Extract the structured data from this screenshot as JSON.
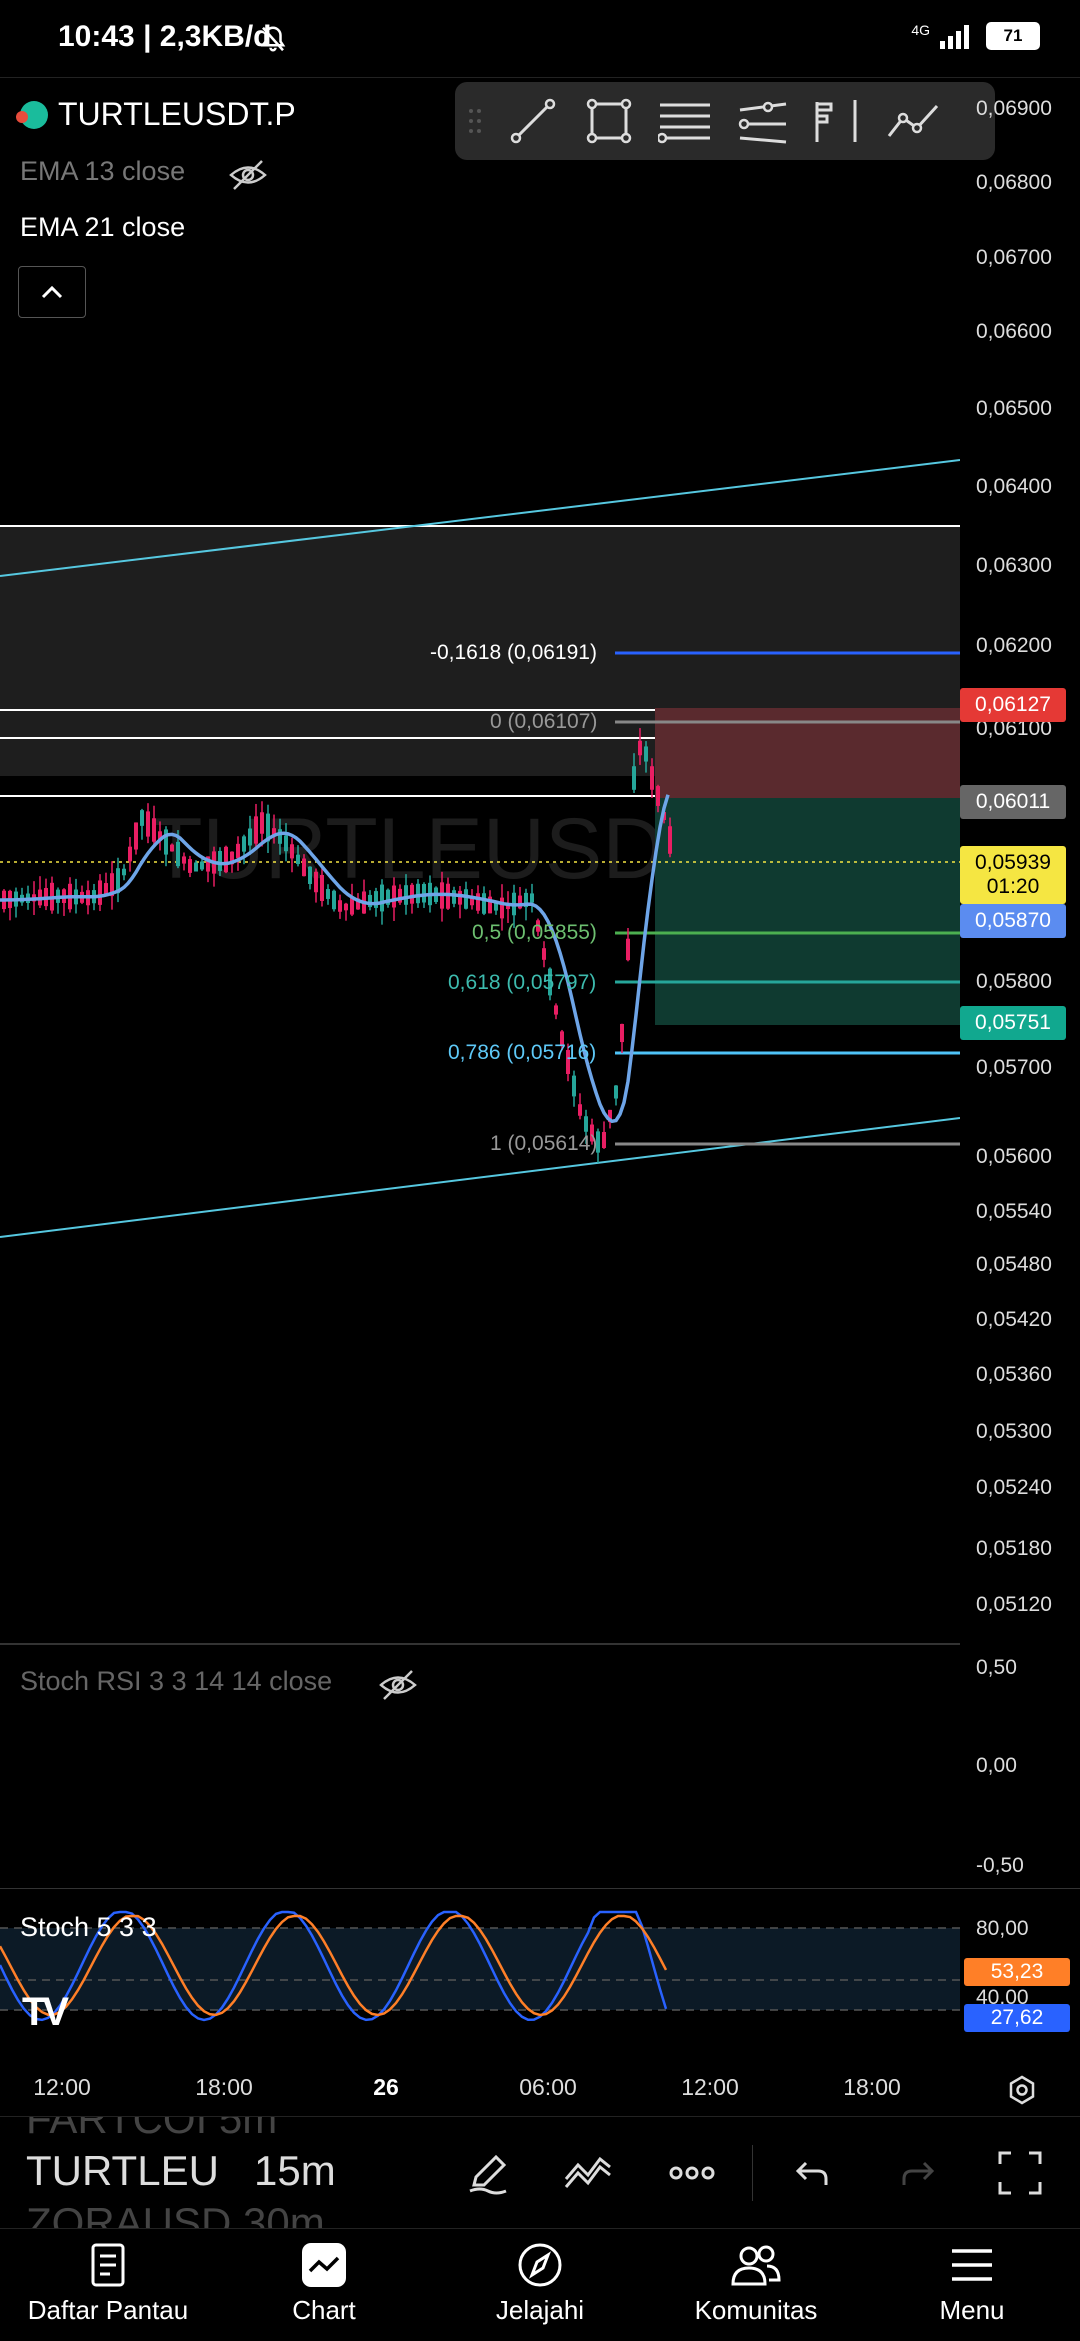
{
  "status_bar": {
    "time": "10:43 | 2,3KB/d",
    "network": "4G",
    "battery": "71"
  },
  "chart": {
    "symbol": "TURTLEUSDT.P",
    "watermark": "TURTLEUSDT.P",
    "indicators": {
      "ema13": "EMA 13 close",
      "ema21": "EMA 21 close"
    },
    "price_ticks": [
      "0,06900",
      "0,06800",
      "0,06700",
      "0,06600",
      "0,06500",
      "0,06400",
      "0,06300",
      "0,06200",
      "0,06100",
      "0,05800",
      "0,05700",
      "0,05600",
      "0,05540",
      "0,05480",
      "0,05420",
      "0,05360",
      "0,05300",
      "0,05240",
      "0,05180",
      "0,05120"
    ],
    "price_tags": {
      "stop": "0,06127",
      "entry": "0,06011",
      "current": "0,05939",
      "countdown": "01:20",
      "ema": "0,05870",
      "target": "0,05751"
    },
    "fib_levels": [
      {
        "label": "-0,1618 (0,06191)",
        "color": "#2962ff"
      },
      {
        "label": "0 (0,06107)",
        "color": "#888888"
      },
      {
        "label": "0,5 (0,05855)",
        "color": "#4caf50"
      },
      {
        "label": "0,618 (0,05797)",
        "color": "#26a69a"
      },
      {
        "label": "0,786 (0,05716)",
        "color": "#4fc3f7"
      },
      {
        "label": "1 (0,05614)",
        "color": "#888888"
      }
    ],
    "colors": {
      "up": "#26a69a",
      "down": "#e91e63",
      "ema": "#6ea5e8",
      "channel": "#56c8e0"
    }
  },
  "stoch_rsi": {
    "label": "Stoch RSI 3 3 14 14 close",
    "ticks": [
      "0,50",
      "0,00",
      "-0,50"
    ]
  },
  "stoch": {
    "label": "Stoch 5 3 3",
    "ticks": [
      "80,00",
      "40,00"
    ],
    "k": "53,23",
    "d": "27,62"
  },
  "time_axis": [
    "12:00",
    "18:00",
    "26",
    "06:00",
    "12:00",
    "18:00"
  ],
  "bottom_toolbar": {
    "ghost_above": "FARTCOI 5m",
    "symbol": "TURTLEU",
    "interval": "15m",
    "ghost_below": "ZORAUSD 30m"
  },
  "nav": [
    {
      "label": "Daftar Pantau",
      "icon": "watchlist-icon"
    },
    {
      "label": "Chart",
      "icon": "chart-icon"
    },
    {
      "label": "Jelajahi",
      "icon": "compass-icon"
    },
    {
      "label": "Komunitas",
      "icon": "community-icon"
    },
    {
      "label": "Menu",
      "icon": "menu-icon"
    }
  ]
}
